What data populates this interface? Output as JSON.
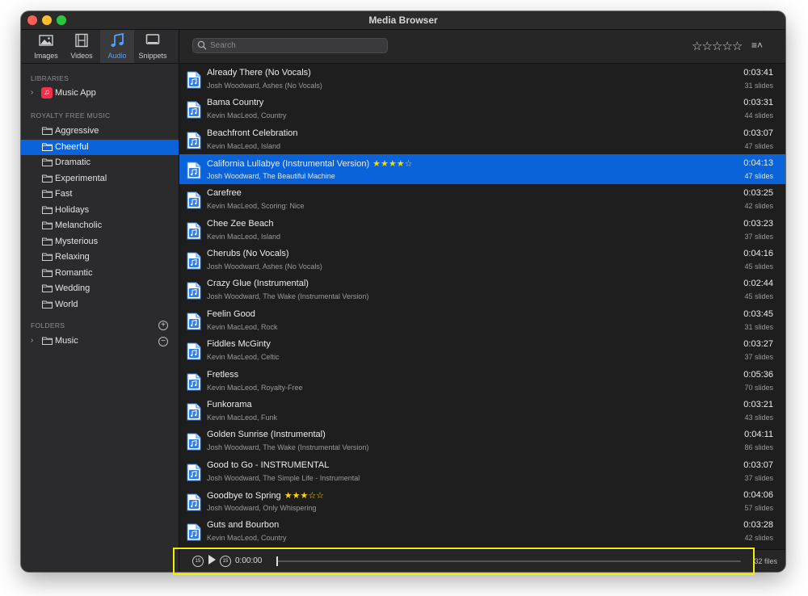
{
  "window": {
    "title": "Media Browser"
  },
  "colors": {
    "accent": "#0a63d8",
    "star": "#ffd60a",
    "highlight": "#f0f000"
  },
  "tabs": [
    {
      "label": "Images",
      "icon": "photo-icon"
    },
    {
      "label": "Videos",
      "icon": "film-icon"
    },
    {
      "label": "Audio",
      "icon": "music-note-icon",
      "active": true
    },
    {
      "label": "Snippets",
      "icon": "monitor-icon"
    }
  ],
  "sidebar": {
    "libraries_header": "LIBRARIES",
    "music_app": "Music App",
    "royalty_header": "ROYALTY FREE MUSIC",
    "folders": [
      "Aggressive",
      "Cheerful",
      "Dramatic",
      "Experimental",
      "Fast",
      "Holidays",
      "Melancholic",
      "Mysterious",
      "Relaxing",
      "Romantic",
      "Wedding",
      "World"
    ],
    "selected_folder": "Cheerful",
    "folders_header": "FOLDERS",
    "user_folders": [
      "Music"
    ]
  },
  "toolbar": {
    "search_placeholder": "Search",
    "rating_filter": "☆☆☆☆☆",
    "sort_icon": "list-sort-icon"
  },
  "tracks": [
    {
      "title": "Already There (No Vocals)",
      "subtitle": "Josh Woodward, Ashes (No Vocals)",
      "duration": "0:03:41",
      "slides": "31 slides",
      "stars": ""
    },
    {
      "title": "Bama Country",
      "subtitle": "Kevin MacLeod, Country",
      "duration": "0:03:31",
      "slides": "44 slides",
      "stars": ""
    },
    {
      "title": "Beachfront Celebration",
      "subtitle": "Kevin MacLeod, Island",
      "duration": "0:03:07",
      "slides": "47 slides",
      "stars": ""
    },
    {
      "title": "California Lullabye (Instrumental Version)",
      "subtitle": "Josh Woodward, The Beautiful Machine",
      "duration": "0:04:13",
      "slides": "47 slides",
      "stars": "★★★★☆",
      "selected": true
    },
    {
      "title": "Carefree",
      "subtitle": "Kevin MacLeod, Scoring: Nice",
      "duration": "0:03:25",
      "slides": "42 slides",
      "stars": ""
    },
    {
      "title": "Chee Zee Beach",
      "subtitle": "Kevin MacLeod, Island",
      "duration": "0:03:23",
      "slides": "37 slides",
      "stars": ""
    },
    {
      "title": "Cherubs (No Vocals)",
      "subtitle": "Josh Woodward, Ashes (No Vocals)",
      "duration": "0:04:16",
      "slides": "45 slides",
      "stars": ""
    },
    {
      "title": "Crazy Glue (Instrumental)",
      "subtitle": "Josh Woodward, The Wake (Instrumental Version)",
      "duration": "0:02:44",
      "slides": "45 slides",
      "stars": ""
    },
    {
      "title": "Feelin Good",
      "subtitle": "Kevin MacLeod, Rock",
      "duration": "0:03:45",
      "slides": "31 slides",
      "stars": ""
    },
    {
      "title": "Fiddles McGinty",
      "subtitle": "Kevin MacLeod, Celtic",
      "duration": "0:03:27",
      "slides": "37 slides",
      "stars": ""
    },
    {
      "title": "Fretless",
      "subtitle": "Kevin MacLeod, Royalty-Free",
      "duration": "0:05:36",
      "slides": "70 slides",
      "stars": ""
    },
    {
      "title": "Funkorama",
      "subtitle": "Kevin MacLeod, Funk",
      "duration": "0:03:21",
      "slides": "43 slides",
      "stars": ""
    },
    {
      "title": "Golden Sunrise (Instrumental)",
      "subtitle": "Josh Woodward, The Wake (Instrumental Version)",
      "duration": "0:04:11",
      "slides": "86 slides",
      "stars": ""
    },
    {
      "title": "Good to Go - INSTRUMENTAL",
      "subtitle": "Josh Woodward, The Simple Life - Instrumental",
      "duration": "0:03:07",
      "slides": "37 slides",
      "stars": ""
    },
    {
      "title": "Goodbye to Spring",
      "subtitle": "Josh Woodward, Only Whispering",
      "duration": "0:04:06",
      "slides": "57 slides",
      "stars": "★★★☆☆"
    },
    {
      "title": "Guts and Bourbon",
      "subtitle": "Kevin MacLeod, Country",
      "duration": "0:03:28",
      "slides": "42 slides",
      "stars": ""
    }
  ],
  "player": {
    "skip_back_label": "15",
    "skip_forward_label": "15",
    "time": "0:00:00",
    "progress": 0,
    "file_count": "32 files"
  }
}
